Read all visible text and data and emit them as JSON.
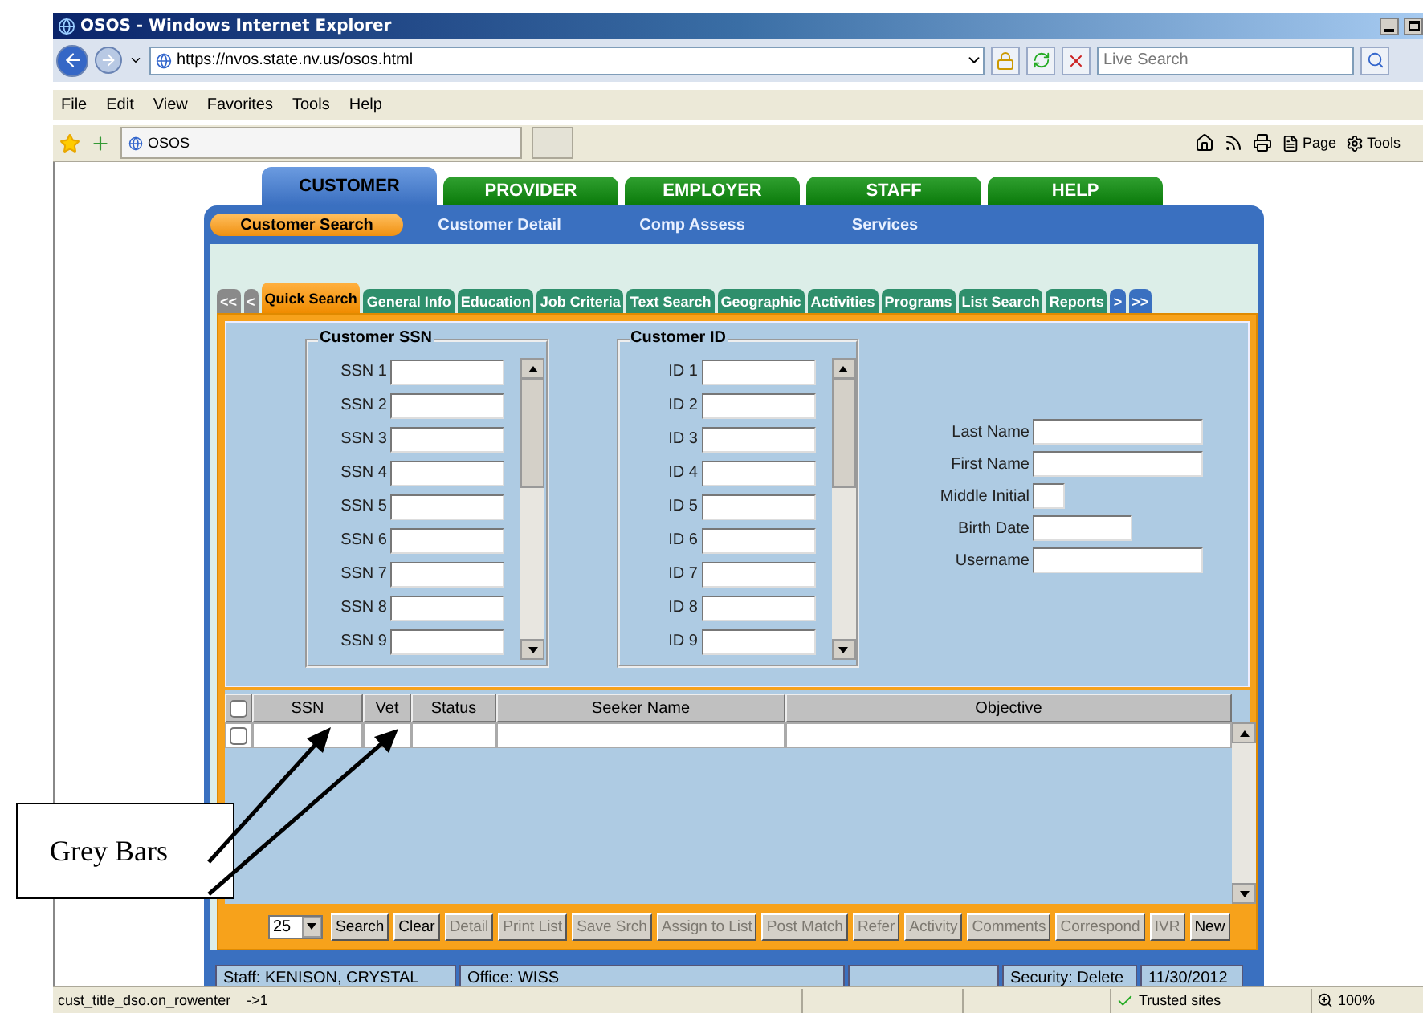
{
  "browser": {
    "title": "OSOS - Windows Internet Explorer",
    "address": "https://nvos.state.nv.us/osos.html",
    "search_placeholder": "Live Search",
    "menu": [
      "File",
      "Edit",
      "View",
      "Favorites",
      "Tools",
      "Help"
    ],
    "tab": "OSOS",
    "toolbar": [
      "Page",
      "Tools"
    ]
  },
  "main_tabs": [
    {
      "label": "CUSTOMER",
      "selected": true
    },
    {
      "label": "PROVIDER",
      "selected": false
    },
    {
      "label": "EMPLOYER",
      "selected": false
    },
    {
      "label": "STAFF",
      "selected": false
    },
    {
      "label": "HELP",
      "selected": false
    }
  ],
  "sub_nav": [
    {
      "label": "Customer Search",
      "selected": true
    },
    {
      "label": "Customer Detail",
      "selected": false
    },
    {
      "label": "Comp Assess",
      "selected": false
    },
    {
      "label": "Services",
      "selected": false
    }
  ],
  "page_tabs": [
    {
      "label": "<<",
      "kind": "nav",
      "selected": false,
      "disabled": true
    },
    {
      "label": "<",
      "kind": "nav",
      "selected": false,
      "disabled": true
    },
    {
      "label": "Quick Search",
      "kind": "tab",
      "selected": true,
      "disabled": false
    },
    {
      "label": "General Info",
      "kind": "tab",
      "selected": false,
      "disabled": false
    },
    {
      "label": "Education",
      "kind": "tab",
      "selected": false,
      "disabled": false
    },
    {
      "label": "Job Criteria",
      "kind": "tab",
      "selected": false,
      "disabled": false
    },
    {
      "label": "Text Search",
      "kind": "tab",
      "selected": false,
      "disabled": false
    },
    {
      "label": "Geographic",
      "kind": "tab",
      "selected": false,
      "disabled": false
    },
    {
      "label": "Activities",
      "kind": "tab",
      "selected": false,
      "disabled": false
    },
    {
      "label": "Programs",
      "kind": "tab",
      "selected": false,
      "disabled": false
    },
    {
      "label": "List Search",
      "kind": "tab",
      "selected": false,
      "disabled": false
    },
    {
      "label": "Reports",
      "kind": "tab",
      "selected": false,
      "disabled": false
    },
    {
      "label": ">",
      "kind": "nav",
      "selected": false,
      "disabled": false
    },
    {
      "label": ">>",
      "kind": "nav",
      "selected": false,
      "disabled": false
    }
  ],
  "ssn_group": {
    "title": "Customer SSN",
    "fields": [
      "SSN 1",
      "SSN 2",
      "SSN 3",
      "SSN 4",
      "SSN 5",
      "SSN 6",
      "SSN 7",
      "SSN 8",
      "SSN 9"
    ]
  },
  "id_group": {
    "title": "Customer ID",
    "fields": [
      "ID 1",
      "ID 2",
      "ID 3",
      "ID 4",
      "ID 5",
      "ID 6",
      "ID 7",
      "ID 8",
      "ID 9"
    ]
  },
  "name_fields": [
    {
      "label": "Last Name",
      "kind": "long"
    },
    {
      "label": "First Name",
      "kind": "long"
    },
    {
      "label": "Middle Initial",
      "kind": "tiny"
    },
    {
      "label": "Birth Date",
      "kind": "medium"
    },
    {
      "label": "Username",
      "kind": "long"
    }
  ],
  "grid": {
    "select_all_checked": false,
    "columns": [
      "SSN",
      "Vet",
      "Status",
      "Seeker Name",
      "Objective"
    ],
    "rows": [
      {
        "checked": false
      }
    ]
  },
  "page_size": "25",
  "buttons": [
    {
      "label": "Search",
      "disabled": false
    },
    {
      "label": "Clear",
      "disabled": false
    },
    {
      "label": "Detail",
      "disabled": true
    },
    {
      "label": "Print List",
      "disabled": true
    },
    {
      "label": "Save Srch",
      "disabled": true
    },
    {
      "label": "Assign to List",
      "disabled": true
    },
    {
      "label": "Post Match",
      "disabled": true
    },
    {
      "label": "Refer",
      "disabled": true
    },
    {
      "label": "Activity",
      "disabled": true
    },
    {
      "label": "Comments",
      "disabled": true
    },
    {
      "label": "Correspond",
      "disabled": true
    },
    {
      "label": "IVR",
      "disabled": true
    },
    {
      "label": "New",
      "disabled": false
    }
  ],
  "status_info": {
    "staff": "Staff: KENISON, CRYSTAL",
    "office": "Office: WISS",
    "security": "Security: Delete",
    "date": "11/30/2012"
  },
  "status_bar": {
    "text": "cust_title_dso.on_rowenter    ->1",
    "zone": "Trusted sites",
    "zoom": "100%"
  },
  "annotation": {
    "label": "Grey Bars"
  }
}
